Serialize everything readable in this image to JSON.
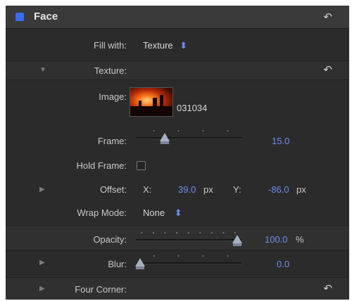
{
  "header": {
    "title": "Face",
    "reset_icon": "reset-arrow-icon",
    "enable_color": "#3b6df0"
  },
  "fill_with": {
    "label": "Fill with:",
    "value": "Texture",
    "stepper": "⬍"
  },
  "texture": {
    "label": "Texture:"
  },
  "image": {
    "label": "Image:",
    "filename": "031034"
  },
  "frame": {
    "label": "Frame:",
    "value": "15.0",
    "level": 0.25
  },
  "hold_frame": {
    "label": "Hold Frame:",
    "checked": false
  },
  "offset": {
    "label": "Offset:",
    "x_label": "X:",
    "x_value": "39.0",
    "x_unit": "px",
    "y_label": "Y:",
    "y_value": "-86.0",
    "y_unit": "px"
  },
  "wrap_mode": {
    "label": "Wrap Mode:",
    "value": "None",
    "stepper": "⬍"
  },
  "opacity": {
    "label": "Opacity:",
    "value": "100.0",
    "unit": "%",
    "level": 1.0
  },
  "blur": {
    "label": "Blur:",
    "value": "0.0",
    "level": 0.0
  },
  "four_corner": {
    "label": "Four Corner:"
  }
}
